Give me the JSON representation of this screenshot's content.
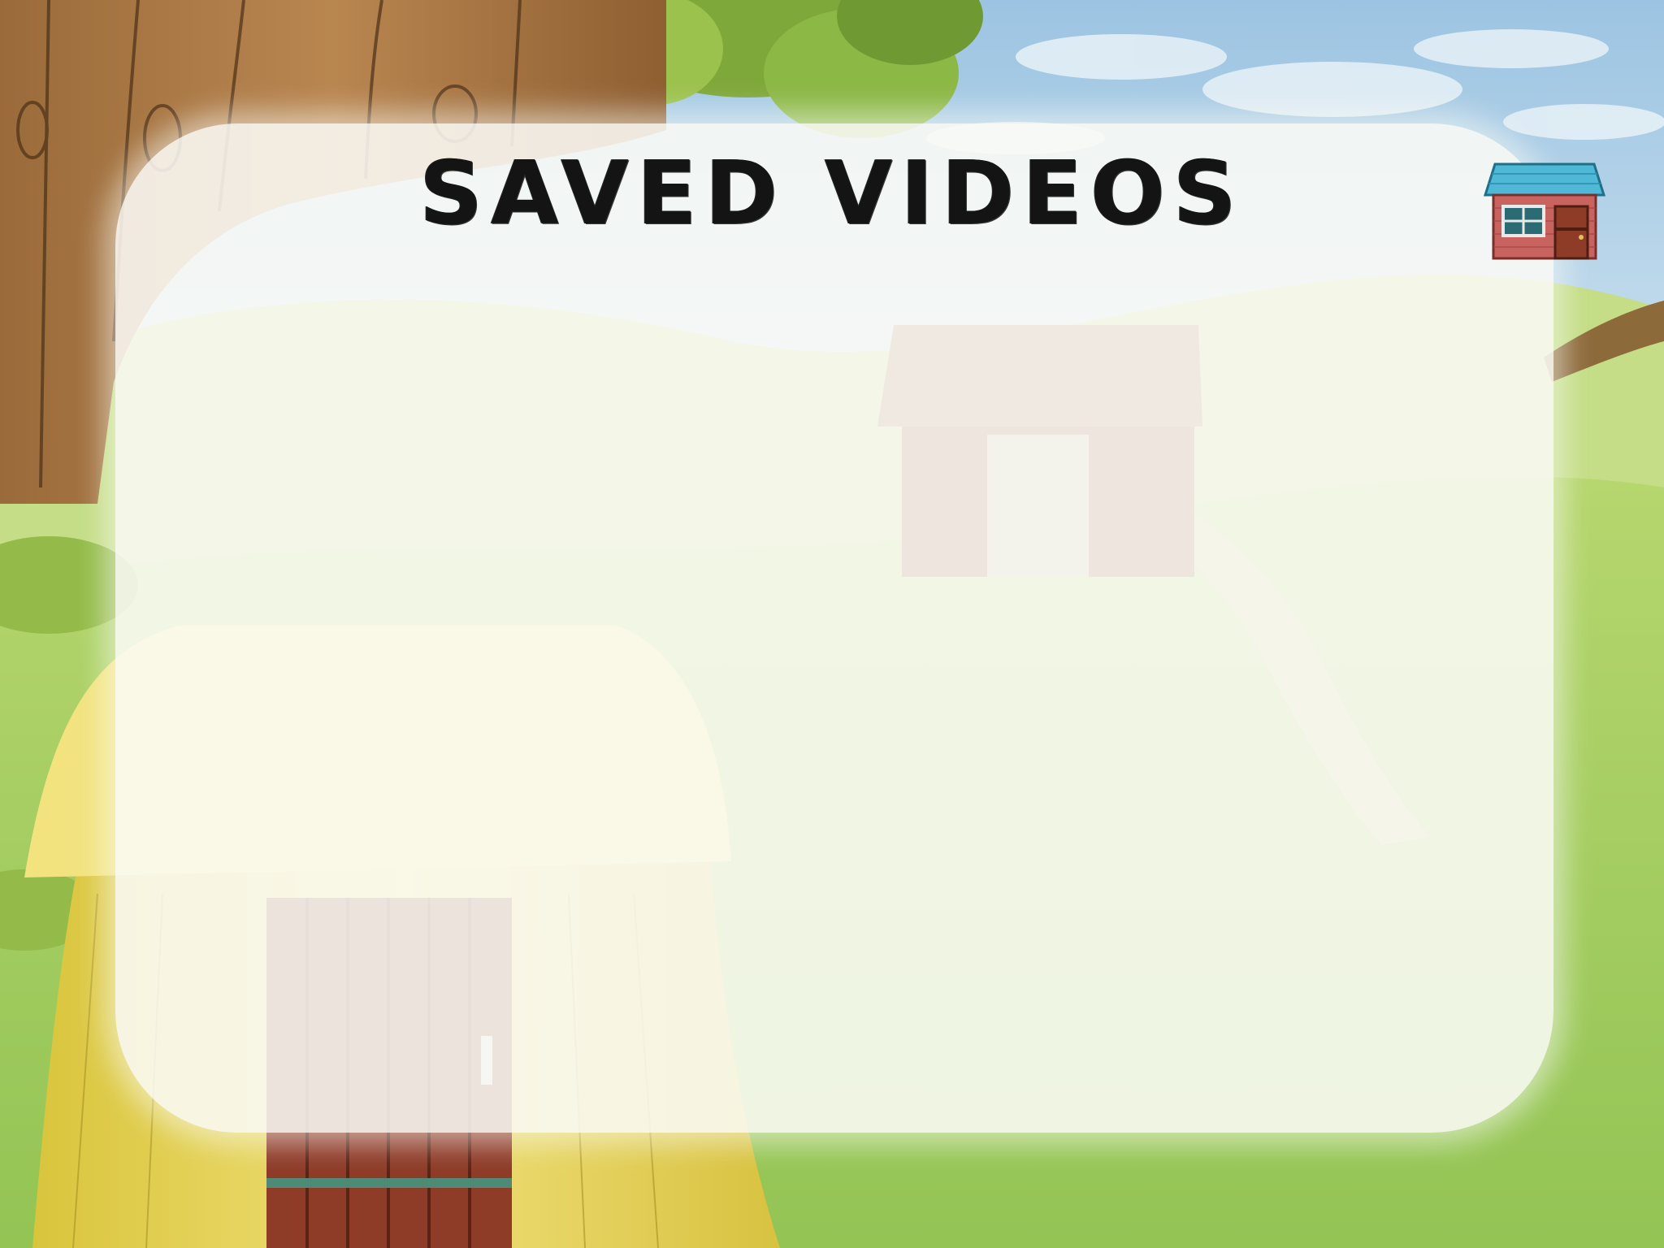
{
  "screen": {
    "title": "SAVED VIDEOS"
  },
  "home_button": {
    "icon": "house-icon"
  },
  "colors": {
    "sky": "#a9cde6",
    "grass": "#a6cf63",
    "panel": "#fafbf6",
    "title_text": "#141414",
    "house_roof": "#4fb8d6",
    "house_wall": "#c9635f"
  }
}
